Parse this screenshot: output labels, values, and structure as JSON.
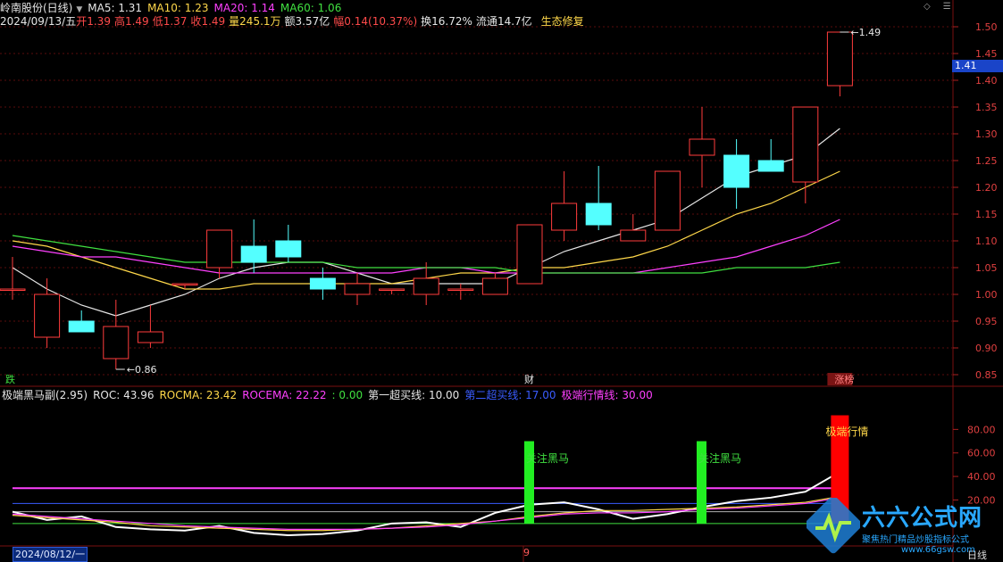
{
  "header": {
    "stock_name": "岭南股份(日线)",
    "ma": [
      {
        "label": "MA5: 1.31",
        "color": "#e6e6e6"
      },
      {
        "label": "MA10: 1.23",
        "color": "#ffd84a"
      },
      {
        "label": "MA20: 1.14",
        "color": "#ff40ff"
      },
      {
        "label": "MA60: 1.06",
        "color": "#40e040"
      }
    ],
    "quote_date": "2024/09/13/五",
    "quote_items": [
      {
        "label": "开",
        "value": "1.39",
        "label_color": "#ff4a4a",
        "value_color": "#ff4a4a"
      },
      {
        "label": "高",
        "value": "1.49",
        "label_color": "#ff4a4a",
        "value_color": "#ff4a4a"
      },
      {
        "label": "低",
        "value": "1.37",
        "label_color": "#ff4a4a",
        "value_color": "#ff4a4a"
      },
      {
        "label": "收",
        "value": "1.49",
        "label_color": "#ff4a4a",
        "value_color": "#ff4a4a"
      },
      {
        "label": "量",
        "value": "245.1万",
        "label_color": "#ffd84a",
        "value_color": "#ffd84a"
      },
      {
        "label": "额",
        "value": "3.57亿",
        "label_color": "#e6e6e6",
        "value_color": "#e6e6e6"
      },
      {
        "label": "幅",
        "value": "0.14(10.37%)",
        "label_color": "#ff4a4a",
        "value_color": "#ff4a4a"
      },
      {
        "label": "换",
        "value": "16.72%",
        "label_color": "#e6e6e6",
        "value_color": "#e6e6e6"
      },
      {
        "label": "流通",
        "value": "14.7亿",
        "label_color": "#e6e6e6",
        "value_color": "#e6e6e6"
      }
    ],
    "sector": "生态修复",
    "corner_icons": [
      "diamond-icon",
      "menu-icon"
    ]
  },
  "price_axis": {
    "ticks": [
      "1.50",
      "1.45",
      "1.40",
      "1.35",
      "1.30",
      "1.25",
      "1.20",
      "1.15",
      "1.10",
      "1.05",
      "1.00",
      "0.95",
      "0.90",
      "0.85"
    ],
    "current": "1.41"
  },
  "chart_data": [
    {
      "type": "candlestick",
      "title": "",
      "ylim": [
        0.83,
        1.53
      ],
      "candles": [
        {
          "o": 1.01,
          "h": 1.07,
          "l": 0.99,
          "c": 1.01
        },
        {
          "o": 0.92,
          "h": 1.03,
          "l": 0.9,
          "c": 1.0
        },
        {
          "o": 0.95,
          "h": 0.97,
          "l": 0.93,
          "c": 0.93
        },
        {
          "o": 0.88,
          "h": 0.99,
          "l": 0.86,
          "c": 0.94
        },
        {
          "o": 0.91,
          "h": 0.98,
          "l": 0.9,
          "c": 0.93
        },
        {
          "o": 1.02,
          "h": 1.02,
          "l": 1.01,
          "c": 1.02
        },
        {
          "o": 1.05,
          "h": 1.12,
          "l": 1.03,
          "c": 1.12
        },
        {
          "o": 1.09,
          "h": 1.14,
          "l": 1.04,
          "c": 1.06
        },
        {
          "o": 1.1,
          "h": 1.13,
          "l": 1.06,
          "c": 1.07
        },
        {
          "o": 1.03,
          "h": 1.05,
          "l": 0.99,
          "c": 1.01
        },
        {
          "o": 1.0,
          "h": 1.04,
          "l": 0.98,
          "c": 1.02
        },
        {
          "o": 1.01,
          "h": 1.01,
          "l": 1.0,
          "c": 1.01
        },
        {
          "o": 1.0,
          "h": 1.06,
          "l": 0.98,
          "c": 1.03
        },
        {
          "o": 1.01,
          "h": 1.02,
          "l": 0.99,
          "c": 1.01
        },
        {
          "o": 1.0,
          "h": 1.04,
          "l": 1.0,
          "c": 1.03
        },
        {
          "o": 1.02,
          "h": 1.13,
          "l": 1.02,
          "c": 1.13
        },
        {
          "o": 1.12,
          "h": 1.23,
          "l": 1.1,
          "c": 1.17
        },
        {
          "o": 1.17,
          "h": 1.24,
          "l": 1.12,
          "c": 1.13
        },
        {
          "o": 1.1,
          "h": 1.15,
          "l": 1.1,
          "c": 1.12
        },
        {
          "o": 1.12,
          "h": 1.23,
          "l": 1.12,
          "c": 1.23
        },
        {
          "o": 1.26,
          "h": 1.35,
          "l": 1.2,
          "c": 1.29
        },
        {
          "o": 1.26,
          "h": 1.29,
          "l": 1.16,
          "c": 1.2
        },
        {
          "o": 1.25,
          "h": 1.29,
          "l": 1.23,
          "c": 1.23
        },
        {
          "o": 1.21,
          "h": 1.35,
          "l": 1.17,
          "c": 1.35
        },
        {
          "o": 1.39,
          "h": 1.49,
          "l": 1.37,
          "c": 1.49
        }
      ],
      "ma_lines": [
        {
          "name": "MA5",
          "color": "#e6e6e6",
          "values": [
            1.05,
            1.01,
            0.98,
            0.96,
            0.98,
            1.0,
            1.03,
            1.05,
            1.06,
            1.06,
            1.04,
            1.02,
            1.02,
            1.02,
            1.02,
            1.05,
            1.08,
            1.1,
            1.12,
            1.14,
            1.18,
            1.22,
            1.24,
            1.26,
            1.31
          ]
        },
        {
          "name": "MA10",
          "color": "#ffd84a",
          "values": [
            1.1,
            1.09,
            1.07,
            1.05,
            1.03,
            1.01,
            1.01,
            1.02,
            1.02,
            1.02,
            1.02,
            1.02,
            1.03,
            1.04,
            1.04,
            1.05,
            1.05,
            1.06,
            1.07,
            1.09,
            1.12,
            1.15,
            1.17,
            1.2,
            1.23
          ]
        },
        {
          "name": "MA20",
          "color": "#ff40ff",
          "values": [
            1.09,
            1.08,
            1.07,
            1.07,
            1.06,
            1.05,
            1.04,
            1.04,
            1.04,
            1.04,
            1.04,
            1.04,
            1.05,
            1.05,
            1.04,
            1.04,
            1.04,
            1.04,
            1.04,
            1.05,
            1.06,
            1.07,
            1.09,
            1.11,
            1.14
          ]
        },
        {
          "name": "MA60",
          "color": "#40e040",
          "values": [
            1.11,
            1.1,
            1.09,
            1.08,
            1.07,
            1.06,
            1.06,
            1.06,
            1.06,
            1.06,
            1.05,
            1.05,
            1.05,
            1.05,
            1.05,
            1.04,
            1.04,
            1.04,
            1.04,
            1.04,
            1.04,
            1.05,
            1.05,
            1.05,
            1.06
          ]
        }
      ],
      "annotations": [
        {
          "text": "1.49",
          "candle": 24,
          "price": 1.49
        },
        {
          "text": "0.86",
          "candle": 3,
          "price": 0.86
        }
      ],
      "markers": [
        {
          "text": "跌",
          "candle": 0,
          "color": "#40e040"
        },
        {
          "text": "财",
          "candle": 15,
          "color": "#e6e6e6"
        },
        {
          "text": "涨榜",
          "candle": 24,
          "color": "#ff8080"
        }
      ]
    },
    {
      "type": "bar+line",
      "title": "",
      "ylim": [
        -10,
        100
      ],
      "yticks": [
        "80.00",
        "60.00",
        "40.00",
        "20.00"
      ],
      "legend_items": [
        {
          "label": "极端黑马副(2.95)",
          "color": "#e6e6e6"
        },
        {
          "label": "ROC: 43.96",
          "color": "#e6e6e6"
        },
        {
          "label": "ROCMA: 23.42",
          "color": "#ffd84a"
        },
        {
          "label": "ROCEMA: 22.22",
          "color": "#ff40ff"
        },
        {
          "label": ": 0.00",
          "color": "#40e040"
        },
        {
          "label": "第一超买线: 10.00",
          "color": "#e6e6e6"
        },
        {
          "label": "第二超买线: 17.00",
          "color": "#3a5cff"
        },
        {
          "label": "极端行情线: 30.00",
          "color": "#ff40ff"
        }
      ],
      "lines": [
        {
          "name": "ROC",
          "color": "#ffffff",
          "values": [
            10,
            3,
            6,
            -3,
            -5,
            -6,
            -2,
            -8,
            -10,
            -9,
            -6,
            0,
            1,
            -3,
            9,
            16,
            18,
            12,
            4,
            8,
            14,
            19,
            22,
            27,
            44
          ]
        },
        {
          "name": "ROCMA",
          "color": "#ffd84a",
          "values": [
            7,
            5,
            3,
            1,
            -2,
            -3,
            -4,
            -5,
            -6,
            -6,
            -5,
            -4,
            -2,
            0,
            2,
            6,
            9,
            11,
            11,
            12,
            13,
            14,
            16,
            18,
            23
          ]
        },
        {
          "name": "ROCEMA",
          "color": "#ff40ff",
          "values": [
            8,
            6,
            4,
            2,
            0,
            -2,
            -3,
            -4,
            -5,
            -5,
            -5,
            -4,
            -3,
            -1,
            2,
            5,
            8,
            9,
            9,
            10,
            12,
            13,
            15,
            17,
            22
          ]
        }
      ],
      "h_lines": [
        {
          "name": "零轴",
          "value": 0,
          "color": "#40e040"
        },
        {
          "name": "第一超买线",
          "value": 10,
          "color": "#b0b0b0"
        },
        {
          "name": "第二超买线",
          "value": 17,
          "color": "#3a5cff"
        },
        {
          "name": "极端行情线",
          "value": 30,
          "color": "#ff40ff"
        }
      ],
      "signal_bars": [
        {
          "candle": 15,
          "value": 70,
          "color": "#22ee22",
          "label": "关注黑马"
        },
        {
          "candle": 20,
          "value": 70,
          "color": "#22ee22",
          "label": "关注黑马"
        },
        {
          "candle": 24,
          "value": 92,
          "color": "#ff0000",
          "label": "极端行情"
        }
      ]
    }
  ],
  "bottom": {
    "date_start": "2024/08/12/一",
    "month_marker": "9",
    "period": "日线"
  },
  "watermark": {
    "text": "六六公式网",
    "tagline": "聚焦热门精品炒股指标公式",
    "url": "www.66gsw.com"
  }
}
